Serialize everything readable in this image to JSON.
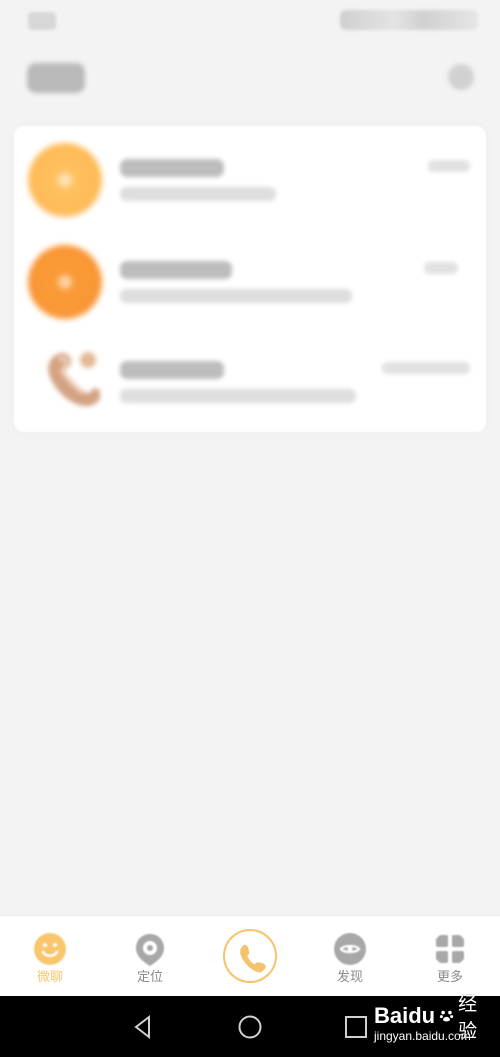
{
  "status_bar": {
    "left_icon": "blurred-status-icon",
    "right_icons": "blurred-system-icons"
  },
  "header": {
    "title": "",
    "action_icon": "settings-icon"
  },
  "messages": [
    {
      "avatar": "orange-circle-avatar",
      "title": "",
      "subtitle": "",
      "time": ""
    },
    {
      "avatar": "orange-circle-avatar",
      "title": "",
      "subtitle": "",
      "time": ""
    },
    {
      "avatar": "phone-avatar",
      "title": "",
      "subtitle": "",
      "time": ""
    }
  ],
  "tabs": [
    {
      "label": "微聊",
      "icon": "smile-chat-icon",
      "active": true
    },
    {
      "label": "定位",
      "icon": "location-pin-icon",
      "active": false
    },
    {
      "label": "",
      "icon": "phone-call-icon",
      "active": false
    },
    {
      "label": "发现",
      "icon": "discover-icon",
      "active": false
    },
    {
      "label": "更多",
      "icon": "grid-menu-icon",
      "active": false
    }
  ],
  "navigation": {
    "back": "back-triangle-icon",
    "home": "home-circle-icon",
    "recent": "recent-square-icon"
  },
  "watermark": {
    "brand": "Baidu",
    "brand_cn": "经验",
    "url": "jingyan.baidu.com"
  },
  "colors": {
    "background": "#f3f3f3",
    "accent": "#f8c66d",
    "orange_light": "#ffbb57",
    "orange_dark": "#f99637",
    "tab_text": "#8a8a8a",
    "nav_bar": "#000000"
  }
}
